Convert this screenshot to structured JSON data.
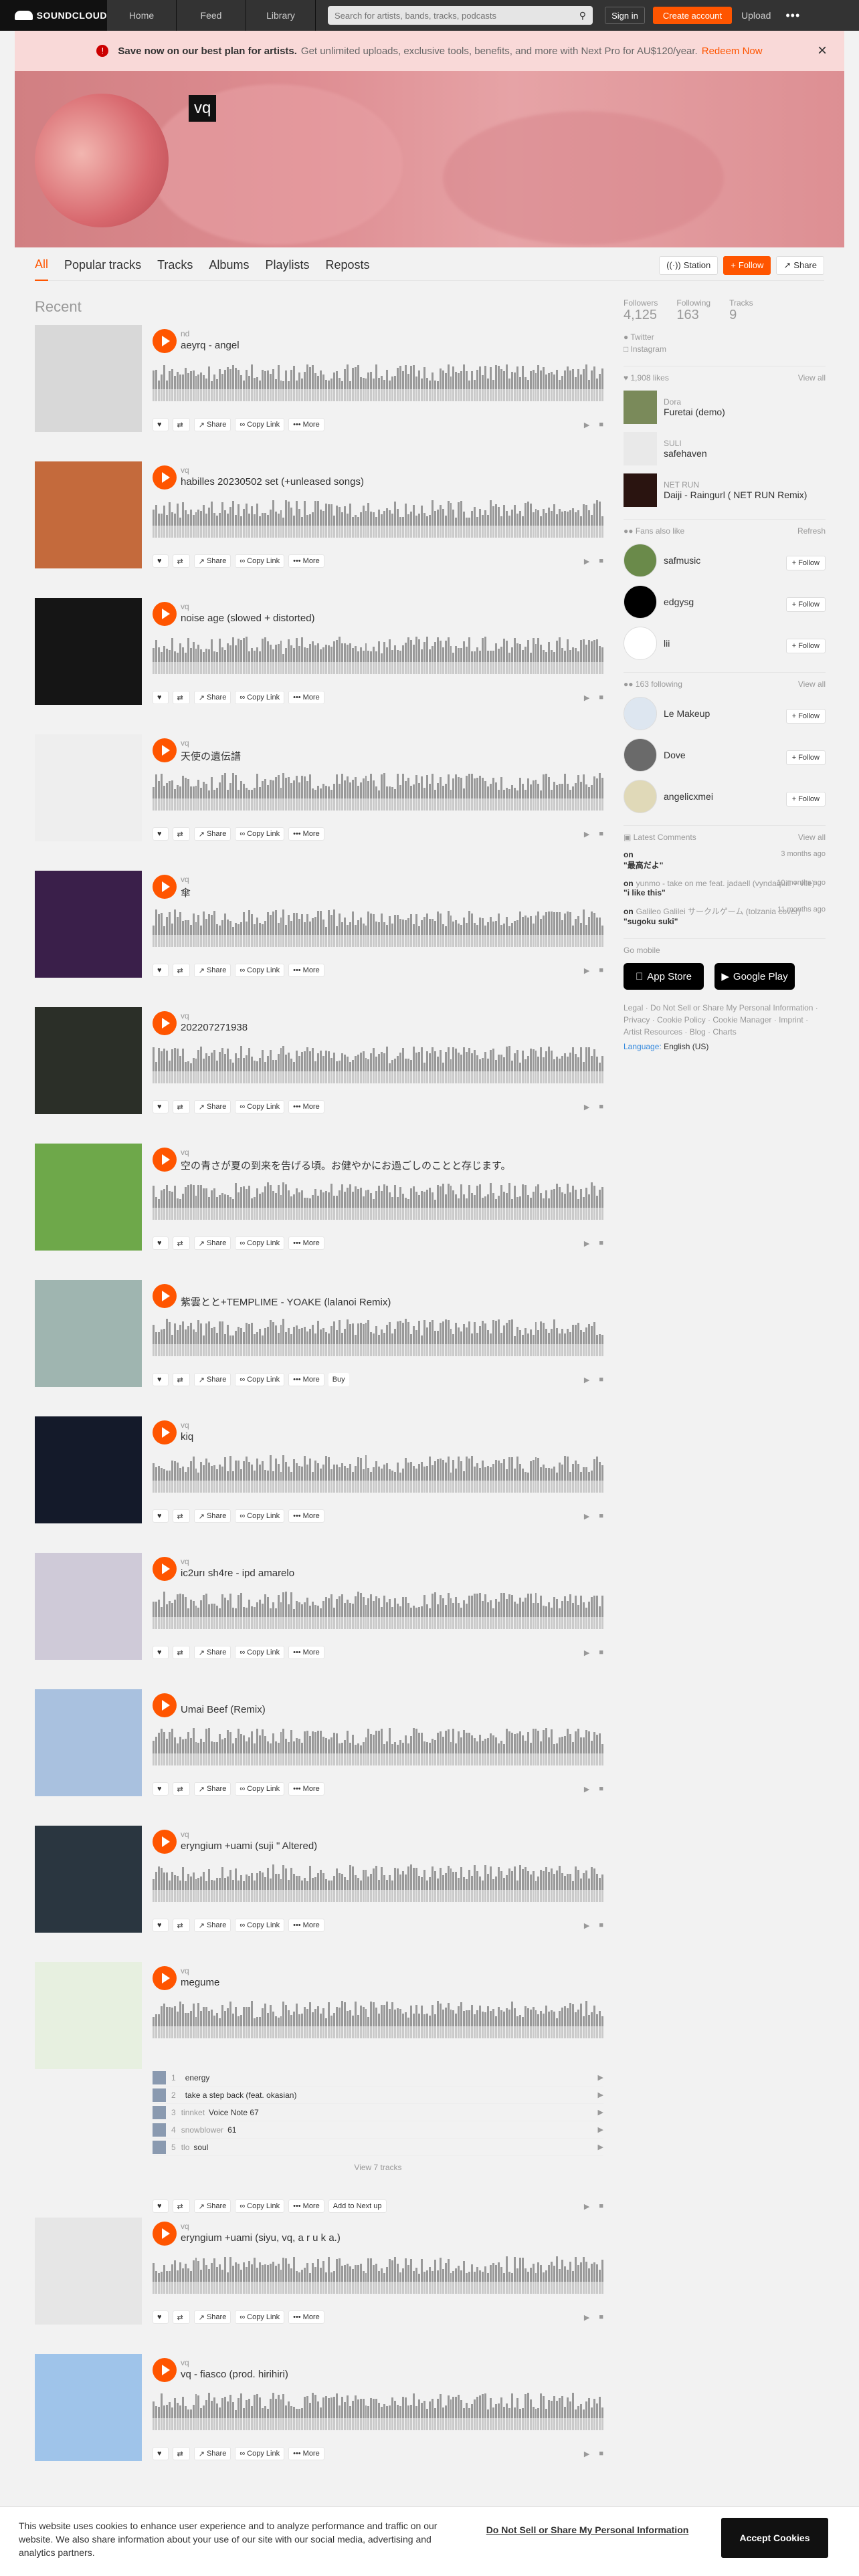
{
  "topbar": {
    "brand": "SOUNDCLOUD",
    "nav": [
      "Home",
      "Feed",
      "Library"
    ],
    "search_placeholder": "Search for artists, bands, tracks, podcasts",
    "signin": "Sign in",
    "create": "Create account",
    "upload": "Upload",
    "more": "•••"
  },
  "promo": {
    "lead": "Save now on our best plan for artists.",
    "rest": "Get unlimited uploads, exclusive tools, benefits, and more with Next Pro for AU$120/year.",
    "link": "Redeem Now"
  },
  "profile": {
    "name": "vq"
  },
  "tabs": [
    "All",
    "Popular tracks",
    "Tracks",
    "Albums",
    "Playlists",
    "Reposts"
  ],
  "actions": {
    "station": "Station",
    "follow": "Follow",
    "share": "Share"
  },
  "main": {
    "heading": "Recent"
  },
  "track_buttons": {
    "share": "Share",
    "copy": "Copy Link",
    "more": "More",
    "buy": "Buy",
    "addnext": "Add to Next up",
    "viewall": "View 7 tracks"
  },
  "tracks": [
    {
      "artist": "nd",
      "title": "aeyrq - angel",
      "date": "",
      "art": "#d8d8d8",
      "tag": "",
      "likes": "",
      "reposts": "",
      "plays": "",
      "comments": "",
      "dur": ""
    },
    {
      "artist": "vq",
      "title": "habilles 20230502 set (+unleased songs)",
      "date": "",
      "art": "#c46a3c",
      "tag": "",
      "likes": "",
      "reposts": "",
      "plays": "",
      "comments": "",
      "dur": ""
    },
    {
      "artist": "vq",
      "title": "noise age (slowed + distorted)",
      "date": "",
      "art": "#151515",
      "tag": "",
      "likes": "",
      "reposts": "",
      "plays": "",
      "comments": "",
      "dur": ""
    },
    {
      "artist": "vq",
      "title": "天使の遺伝譜",
      "date": "",
      "art": "#eeeeee",
      "tag": "",
      "likes": "",
      "reposts": "",
      "plays": "",
      "comments": "",
      "dur": ""
    },
    {
      "artist": "vq",
      "title": "傘",
      "date": "",
      "art": "#3a1f4a",
      "tag": "",
      "likes": "",
      "reposts": "",
      "plays": "",
      "comments": "",
      "dur": ""
    },
    {
      "artist": "vq",
      "title": "202207271938",
      "date": "",
      "art": "#2b2f28",
      "tag": "",
      "likes": "",
      "reposts": "",
      "plays": "",
      "comments": "",
      "dur": ""
    },
    {
      "artist": "vq",
      "title": "空の青さが夏の到来を告げる頃。お健やかにお過ごしのことと存じます。",
      "date": "",
      "art": "#6ea84a",
      "tag": "",
      "likes": "",
      "reposts": "",
      "plays": "",
      "comments": "",
      "dur": ""
    },
    {
      "artist": "",
      "title": "紫雲とと+TEMPLIME - YOAKE (lalanoi Remix)",
      "date": "",
      "art": "#9fb5b0",
      "tag": "",
      "likes": "",
      "reposts": "",
      "plays": "",
      "comments": "",
      "dur": ""
    },
    {
      "artist": "vq",
      "title": "kiq",
      "date": "",
      "art": "#141a2a",
      "tag": "",
      "likes": "",
      "reposts": "",
      "plays": "",
      "comments": "",
      "dur": ""
    },
    {
      "artist": "vq",
      "title": "ic2urı sh4re - ipd amarelo",
      "date": "",
      "art": "#cfcad8",
      "tag": "",
      "likes": "",
      "reposts": "",
      "plays": "",
      "comments": "",
      "dur": ""
    },
    {
      "artist": "",
      "title": "Umai Beef (Remix)",
      "date": "",
      "art": "#a9c1df",
      "tag": "",
      "likes": "",
      "reposts": "",
      "plays": "",
      "comments": "",
      "dur": ""
    },
    {
      "artist": "vq",
      "title": "eryngium +uami (suji \" Altered)",
      "date": "",
      "art": "#2a3640",
      "tag": "",
      "likes": "",
      "reposts": "",
      "plays": "",
      "comments": "",
      "dur": ""
    }
  ],
  "playlist": {
    "artist": "vq",
    "title": "megume",
    "art": "#e7f0e0",
    "date": "",
    "items": [
      {
        "num": "1",
        "artist": "",
        "title": "energy",
        "count": ""
      },
      {
        "num": "2",
        "artist": "",
        "title": "take a step back (feat. okasian)",
        "count": ""
      },
      {
        "num": "3",
        "artist": "tinnket",
        "title": "Voice Note 67",
        "count": ""
      },
      {
        "num": "4",
        "artist": "snowblower",
        "title": "61",
        "count": ""
      },
      {
        "num": "5",
        "artist": "tlo",
        "title": "soul",
        "count": ""
      }
    ]
  },
  "tracks2": [
    {
      "artist": "vq",
      "title": "eryngium +uami (siyu, vq, a r u k a.)",
      "date": "",
      "art": "#e6e6e6",
      "likes": "",
      "reposts": "",
      "plays": "",
      "comments": "",
      "dur": ""
    },
    {
      "artist": "vq",
      "title": "vq - fiasco (prod. hirihiri)",
      "date": "",
      "art": "#9fc4ea",
      "likes": "",
      "reposts": "",
      "plays": "",
      "comments": "",
      "dur": ""
    }
  ],
  "sidebar": {
    "stats": [
      {
        "label": "Followers",
        "num": "4,125"
      },
      {
        "label": "Following",
        "num": "163"
      },
      {
        "label": "Tracks",
        "num": "9"
      }
    ],
    "twitter": "Twitter",
    "instagram": "Instagram",
    "likes_header": "1,908 likes",
    "view_all": "View all",
    "likes": [
      {
        "artist": "Dora",
        "title": "Furetai (demo)",
        "art": "#7a8a5a"
      },
      {
        "artist": "SULI",
        "title": "safehaven",
        "art": "#e9e9e9"
      },
      {
        "artist": "NET RUN",
        "title": "Daiji - Raingurl ( NET RUN Remix)",
        "art": "#2a1410"
      }
    ],
    "fans_header": "Fans also like",
    "refresh": "Refresh",
    "fans": [
      {
        "name": "safmusic",
        "art": "#6a8a4a"
      },
      {
        "name": "edgysg",
        "art": "#000000"
      },
      {
        "name": "lii",
        "art": "#ffffff"
      }
    ],
    "following_header": "163 following",
    "following": [
      {
        "name": "Le Makeup",
        "art": "#dde6f0"
      },
      {
        "name": "Dove",
        "art": "#6a6a6a"
      },
      {
        "name": "angelicxmei",
        "art": "#e0d9b8"
      }
    ],
    "follow": "Follow",
    "comments_header": "Latest Comments",
    "comments": [
      {
        "on": "on",
        "track": "",
        "text": "\"最高だよ\"",
        "when": "3 months ago"
      },
      {
        "on": "on",
        "track": "yunmo - take on me feat. jadaell (vyndaquill + vile)",
        "text": "\"i like this\"",
        "when": "10 months ago"
      },
      {
        "on": "on",
        "track": "Galileo Galilei サークルゲーム (tolzania cover)",
        "text": "\"sugoku suki\"",
        "when": "11 months ago"
      }
    ],
    "gomobile": "Go mobile",
    "appstore": "App Store",
    "googleplay": "Google Play",
    "footer": "Legal · Do Not Sell or Share My Personal Information · Privacy · Cookie Policy · Cookie Manager · Imprint · Artist Resources · Blog · Charts",
    "language_label": "Language:",
    "language": "English (US)"
  },
  "cookie": {
    "text": "This website uses cookies to enhance user experience and to analyze performance and traffic on our website. We also share information about your use of our site with our social media, advertising and analytics partners.",
    "dns": "Do Not Sell or Share My Personal Information",
    "accept": "Accept Cookies"
  }
}
